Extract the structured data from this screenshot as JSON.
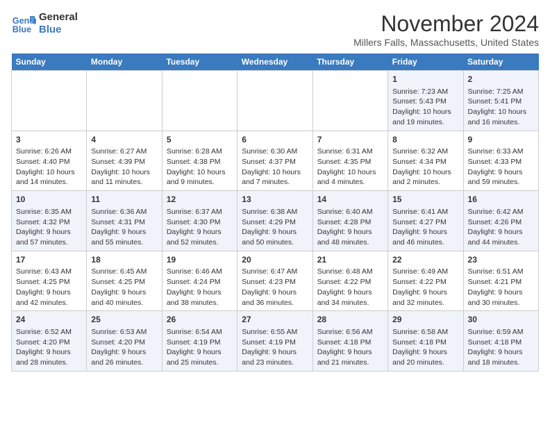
{
  "logo": {
    "line1": "General",
    "line2": "Blue"
  },
  "title": "November 2024",
  "location": "Millers Falls, Massachusetts, United States",
  "headers": [
    "Sunday",
    "Monday",
    "Tuesday",
    "Wednesday",
    "Thursday",
    "Friday",
    "Saturday"
  ],
  "weeks": [
    [
      {
        "day": "",
        "info": ""
      },
      {
        "day": "",
        "info": ""
      },
      {
        "day": "",
        "info": ""
      },
      {
        "day": "",
        "info": ""
      },
      {
        "day": "",
        "info": ""
      },
      {
        "day": "1",
        "info": "Sunrise: 7:23 AM\nSunset: 5:43 PM\nDaylight: 10 hours and 19 minutes."
      },
      {
        "day": "2",
        "info": "Sunrise: 7:25 AM\nSunset: 5:41 PM\nDaylight: 10 hours and 16 minutes."
      }
    ],
    [
      {
        "day": "3",
        "info": "Sunrise: 6:26 AM\nSunset: 4:40 PM\nDaylight: 10 hours and 14 minutes."
      },
      {
        "day": "4",
        "info": "Sunrise: 6:27 AM\nSunset: 4:39 PM\nDaylight: 10 hours and 11 minutes."
      },
      {
        "day": "5",
        "info": "Sunrise: 6:28 AM\nSunset: 4:38 PM\nDaylight: 10 hours and 9 minutes."
      },
      {
        "day": "6",
        "info": "Sunrise: 6:30 AM\nSunset: 4:37 PM\nDaylight: 10 hours and 7 minutes."
      },
      {
        "day": "7",
        "info": "Sunrise: 6:31 AM\nSunset: 4:35 PM\nDaylight: 10 hours and 4 minutes."
      },
      {
        "day": "8",
        "info": "Sunrise: 6:32 AM\nSunset: 4:34 PM\nDaylight: 10 hours and 2 minutes."
      },
      {
        "day": "9",
        "info": "Sunrise: 6:33 AM\nSunset: 4:33 PM\nDaylight: 9 hours and 59 minutes."
      }
    ],
    [
      {
        "day": "10",
        "info": "Sunrise: 6:35 AM\nSunset: 4:32 PM\nDaylight: 9 hours and 57 minutes."
      },
      {
        "day": "11",
        "info": "Sunrise: 6:36 AM\nSunset: 4:31 PM\nDaylight: 9 hours and 55 minutes."
      },
      {
        "day": "12",
        "info": "Sunrise: 6:37 AM\nSunset: 4:30 PM\nDaylight: 9 hours and 52 minutes."
      },
      {
        "day": "13",
        "info": "Sunrise: 6:38 AM\nSunset: 4:29 PM\nDaylight: 9 hours and 50 minutes."
      },
      {
        "day": "14",
        "info": "Sunrise: 6:40 AM\nSunset: 4:28 PM\nDaylight: 9 hours and 48 minutes."
      },
      {
        "day": "15",
        "info": "Sunrise: 6:41 AM\nSunset: 4:27 PM\nDaylight: 9 hours and 46 minutes."
      },
      {
        "day": "16",
        "info": "Sunrise: 6:42 AM\nSunset: 4:26 PM\nDaylight: 9 hours and 44 minutes."
      }
    ],
    [
      {
        "day": "17",
        "info": "Sunrise: 6:43 AM\nSunset: 4:25 PM\nDaylight: 9 hours and 42 minutes."
      },
      {
        "day": "18",
        "info": "Sunrise: 6:45 AM\nSunset: 4:25 PM\nDaylight: 9 hours and 40 minutes."
      },
      {
        "day": "19",
        "info": "Sunrise: 6:46 AM\nSunset: 4:24 PM\nDaylight: 9 hours and 38 minutes."
      },
      {
        "day": "20",
        "info": "Sunrise: 6:47 AM\nSunset: 4:23 PM\nDaylight: 9 hours and 36 minutes."
      },
      {
        "day": "21",
        "info": "Sunrise: 6:48 AM\nSunset: 4:22 PM\nDaylight: 9 hours and 34 minutes."
      },
      {
        "day": "22",
        "info": "Sunrise: 6:49 AM\nSunset: 4:22 PM\nDaylight: 9 hours and 32 minutes."
      },
      {
        "day": "23",
        "info": "Sunrise: 6:51 AM\nSunset: 4:21 PM\nDaylight: 9 hours and 30 minutes."
      }
    ],
    [
      {
        "day": "24",
        "info": "Sunrise: 6:52 AM\nSunset: 4:20 PM\nDaylight: 9 hours and 28 minutes."
      },
      {
        "day": "25",
        "info": "Sunrise: 6:53 AM\nSunset: 4:20 PM\nDaylight: 9 hours and 26 minutes."
      },
      {
        "day": "26",
        "info": "Sunrise: 6:54 AM\nSunset: 4:19 PM\nDaylight: 9 hours and 25 minutes."
      },
      {
        "day": "27",
        "info": "Sunrise: 6:55 AM\nSunset: 4:19 PM\nDaylight: 9 hours and 23 minutes."
      },
      {
        "day": "28",
        "info": "Sunrise: 6:56 AM\nSunset: 4:18 PM\nDaylight: 9 hours and 21 minutes."
      },
      {
        "day": "29",
        "info": "Sunrise: 6:58 AM\nSunset: 4:18 PM\nDaylight: 9 hours and 20 minutes."
      },
      {
        "day": "30",
        "info": "Sunrise: 6:59 AM\nSunset: 4:18 PM\nDaylight: 9 hours and 18 minutes."
      }
    ]
  ]
}
